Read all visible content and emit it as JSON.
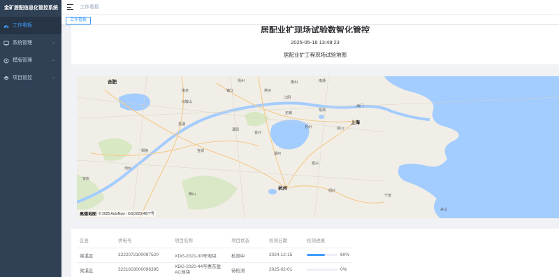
{
  "app": {
    "title": "金矿居配信息化管控系统"
  },
  "sidebar": {
    "items": [
      {
        "label": "工作看板",
        "icon": "dashboard-icon",
        "active": true
      },
      {
        "label": "系统管理",
        "icon": "monitor-icon",
        "expandable": true
      },
      {
        "label": "模版管理",
        "icon": "settings-icon",
        "expandable": true
      },
      {
        "label": "项目管控",
        "icon": "layers-icon",
        "expandable": true
      }
    ]
  },
  "header": {
    "breadcrumb": "工作看板"
  },
  "tags": {
    "active": "工作看板"
  },
  "main": {
    "title": "居配业扩现场试验数智化管控",
    "datetime": "2025-05-16 13:48:23",
    "subtitle": "居配业扩工程现场试验地图"
  },
  "map": {
    "logo": "高德地图",
    "copyright": "© 2025 AutoNavi - GS(2023)4677号",
    "cities": {
      "hefei": "合肥",
      "shanghai": "上海",
      "hangzhou": "杭州",
      "changzhou": "常州",
      "wuxi": "无锡",
      "suzhou": "苏州",
      "nantong": "南通",
      "huzhou": "湖州",
      "jiaxing": "嘉兴",
      "wuhu": "芜湖",
      "maanshan": "马鞍山",
      "tongling": "铜陵",
      "anqing": "安庆",
      "xuancheng": "宣城",
      "chizhou": "池州",
      "shaoxing": "绍兴",
      "ningbo": "宁波",
      "zhoushan": "舟山",
      "nanjing": "南京",
      "zhenjiang": "镇江",
      "yangzhou": "扬州",
      "taizhou": "泰州",
      "haimen": "海门",
      "liyang": "溧阳",
      "yixing": "宜兴",
      "jiangyin": "江阴",
      "changshu": "常熟",
      "kunshan": "昆山",
      "huangshan": "黄山"
    }
  },
  "table": {
    "columns": [
      "区县",
      "供电号",
      "项目名称",
      "项目状态",
      "检测日期",
      "检测进展"
    ],
    "rows": [
      {
        "district": "梁溪区",
        "number": "3222072100097520",
        "name": "XDG-2021-30号地块",
        "status": "检测中",
        "date": "2024-12-15",
        "progress": 60,
        "progress_label": "60%"
      },
      {
        "district": "梁溪区",
        "number": "3221603000096395",
        "name": "XDG-2020-44号惠东盈AC地块",
        "status": "待检测",
        "date": "2025-02-01",
        "progress": 0,
        "progress_label": "0%"
      }
    ]
  },
  "colors": {
    "sidebar": "#304156",
    "accent": "#409eff",
    "water": "#a3ccff"
  }
}
